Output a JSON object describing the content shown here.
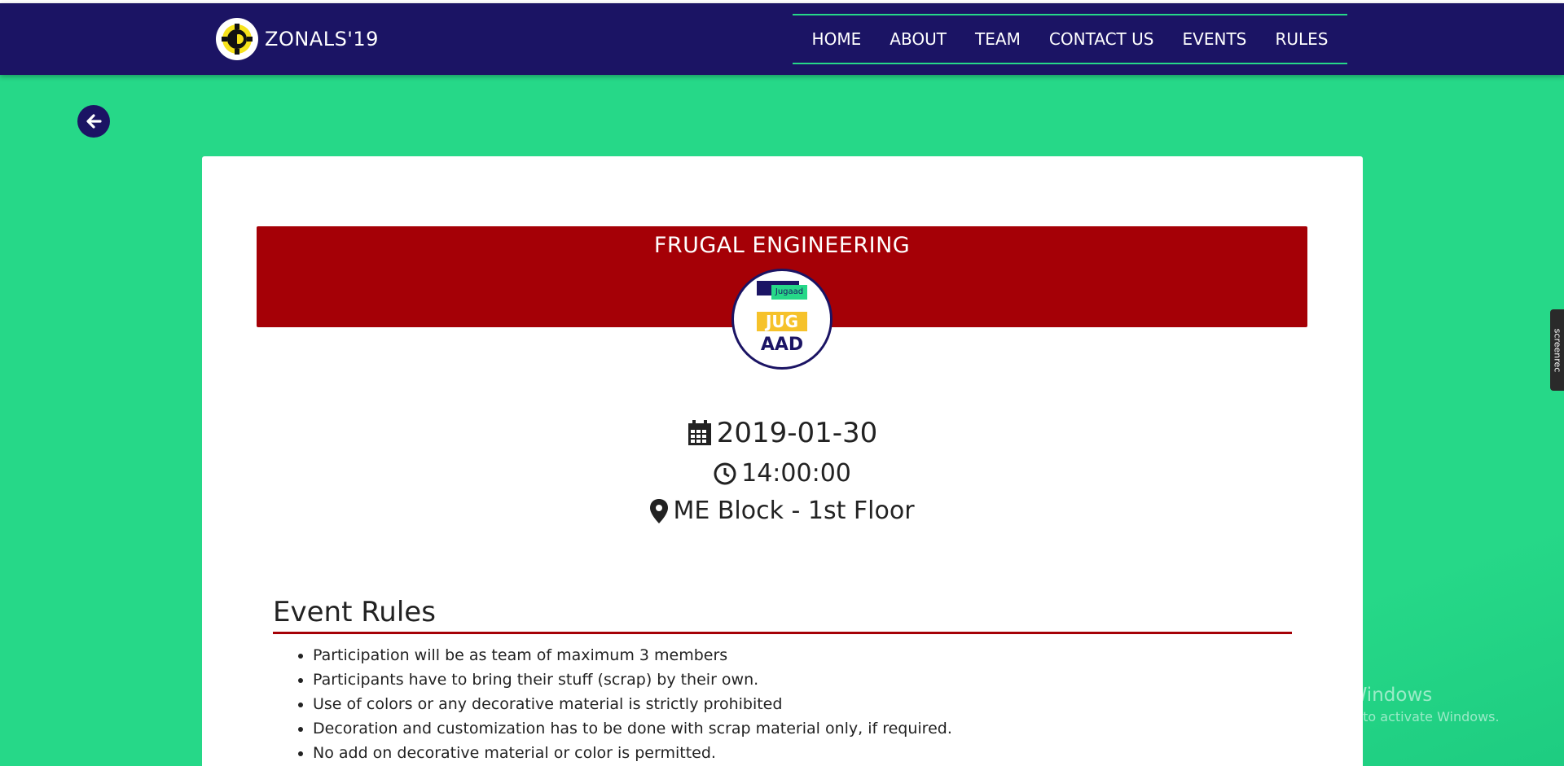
{
  "header": {
    "brand": "ZONALS'19",
    "nav": [
      "HOME",
      "ABOUT",
      "TEAM",
      "CONTACT US",
      "EVENTS",
      "RULES"
    ]
  },
  "event": {
    "title": "FRUGAL ENGINEERING",
    "logo": {
      "tag": "Jugaad",
      "line1": "JUG",
      "line2": "AAD"
    },
    "date": "2019-01-30",
    "time": "14:00:00",
    "venue": "ME Block - 1st Floor"
  },
  "rules": {
    "heading": "Event Rules",
    "items": [
      "Participation will be as team of maximum 3 members",
      "Participants have to bring their stuff (scrap) by their own.",
      "Use of colors or any decorative material is strictly prohibited",
      "Decoration and customization has to be done with scrap material only, if required.",
      "No add on decorative material or color is permitted."
    ]
  },
  "overlay": {
    "windows_title": "Activate Windows",
    "windows_sub": "Go to Settings to activate Windows.",
    "recorder": "screenrec"
  },
  "colors": {
    "navy": "#1b1464",
    "green": "#26d888",
    "red": "#a50006",
    "gold": "#f6c22b"
  },
  "icons": [
    "gear-logo-icon",
    "arrow-left-icon",
    "calendar-icon",
    "clock-icon",
    "map-marker-icon"
  ]
}
